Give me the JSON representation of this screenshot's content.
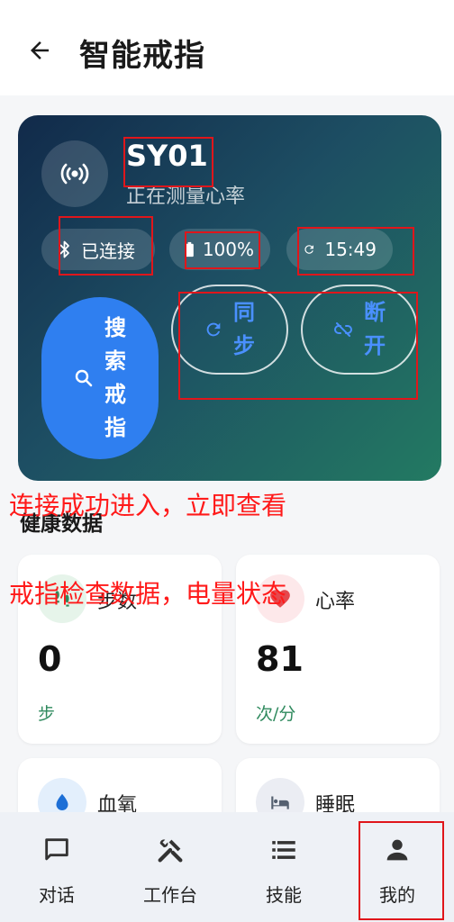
{
  "header": {
    "title": "智能戒指",
    "back_icon": "arrow-left-icon"
  },
  "device": {
    "name": "SY01",
    "status": "正在测量心率",
    "connection": "已连接",
    "battery": "100%",
    "sync_time": "15:49"
  },
  "actions": {
    "search": "搜索戒指",
    "sync": "同步",
    "disconnect": "断开"
  },
  "health": {
    "section_title": "健康数据",
    "metrics": [
      {
        "name": "步数",
        "value": "0",
        "unit": "步"
      },
      {
        "name": "心率",
        "value": "81",
        "unit": "次/分"
      },
      {
        "name": "血氧"
      },
      {
        "name": "睡眠"
      }
    ]
  },
  "tabs": [
    {
      "label": "对话",
      "icon": "chat-icon"
    },
    {
      "label": "工作台",
      "icon": "tools-icon"
    },
    {
      "label": "技能",
      "icon": "list-icon"
    },
    {
      "label": "我的",
      "icon": "person-icon"
    }
  ],
  "annotations": {
    "line1": "连接成功进入，立即查看",
    "line2": "戒指检查数据，电量状态"
  },
  "colors": {
    "accent": "#2f7ff0",
    "annotation": "#ff1a1a",
    "unit_green": "#2f8a5e"
  }
}
